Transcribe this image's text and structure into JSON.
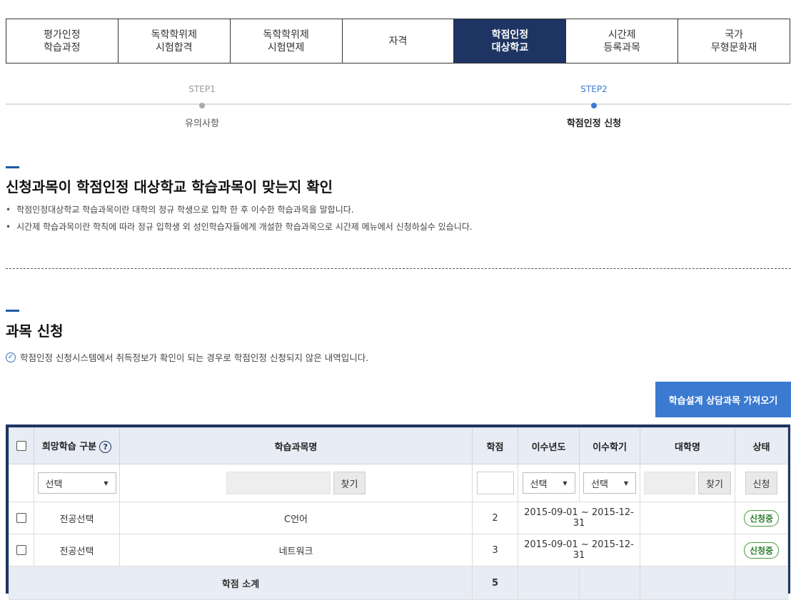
{
  "tabs": [
    {
      "label": "평가인정\n학습과정",
      "active": false
    },
    {
      "label": "독학학위제\n시험합격",
      "active": false
    },
    {
      "label": "독학학위제\n시험면제",
      "active": false
    },
    {
      "label": "자격",
      "active": false
    },
    {
      "label": "학점인정\n대상학교",
      "active": true
    },
    {
      "label": "시간제\n등록과목",
      "active": false
    },
    {
      "label": "국가\n무형문화재",
      "active": false
    }
  ],
  "steps": [
    {
      "label": "STEP1",
      "name": "유의사항"
    },
    {
      "label": "STEP2",
      "name": "학점인정 신청"
    }
  ],
  "section1": {
    "title": "신청과목이 학점인정 대상학교 학습과목이 맞는지 확인",
    "bullets": [
      "학점인정대상학교 학습과목이란 대학의 정규 학생으로 입학 한 후 이수한 학습과목을 말합니다.",
      "시간제 학습과목이란 학칙에 따라 정규 입학생 외 성인학습자들에게 개설한 학습과목으로 시간제 메뉴에서 신청하실수 있습니다."
    ]
  },
  "section2": {
    "title": "과목 신청",
    "note": "학점인정 신청시스템에서 취득정보가 확인이 되는 경우로 학점인정 신청되지 않은 내역입니다.",
    "import_button": "학습설계 상담과목 가져오기"
  },
  "table": {
    "headers": {
      "category": "희망학습 구분",
      "course": "학습과목명",
      "credit": "학점",
      "year": "이수년도",
      "term": "이수학기",
      "univ": "대학명",
      "status": "상태"
    },
    "filter": {
      "category": "선택",
      "find": "찾기",
      "year": "선택",
      "term": "선택",
      "find2": "찾기",
      "apply": "신청"
    },
    "rows": [
      {
        "category": "전공선택",
        "course": "C언어",
        "credit": "2",
        "period": "2015-09-01 ~ 2015-12-31",
        "univ": "",
        "status": "신청중"
      },
      {
        "category": "전공선택",
        "course": "네트워크",
        "credit": "3",
        "period": "2015-09-01 ~ 2015-12-31",
        "univ": "",
        "status": "신청중"
      }
    ],
    "summary": {
      "label": "학점 소계",
      "total": "5"
    }
  }
}
